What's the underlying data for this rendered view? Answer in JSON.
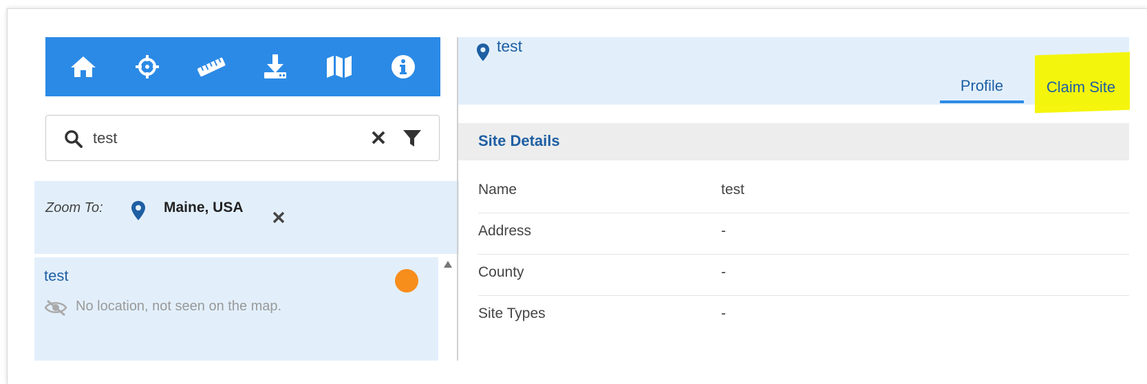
{
  "toolbar": {
    "tools": [
      {
        "icon": "home-icon"
      },
      {
        "icon": "crosshair-icon"
      },
      {
        "icon": "ruler-icon"
      },
      {
        "icon": "download-icon"
      },
      {
        "icon": "map-icon"
      },
      {
        "icon": "info-icon"
      }
    ],
    "color": "#2b8ae6"
  },
  "search": {
    "value": "test",
    "placeholder": ""
  },
  "zoom": {
    "label": "Zoom To:",
    "place": "Maine, USA"
  },
  "results": [
    {
      "title": "test",
      "status_color": "#f78d1b",
      "message": "No location, not seen on the map."
    }
  ],
  "site": {
    "name": "test",
    "tabs": [
      {
        "label": "Profile"
      },
      {
        "label": "Claim Site"
      }
    ],
    "section_title": "Site Details",
    "details": [
      {
        "key": "Name",
        "value": "test"
      },
      {
        "key": "Address",
        "value": "-"
      },
      {
        "key": "County",
        "value": "-"
      },
      {
        "key": "Site Types",
        "value": "-"
      }
    ]
  }
}
